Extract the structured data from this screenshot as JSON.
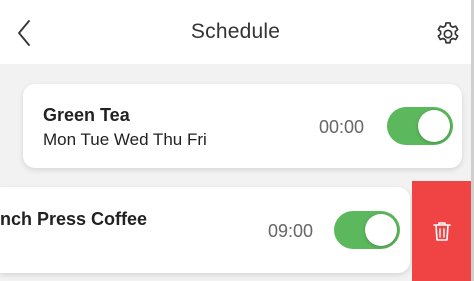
{
  "header": {
    "title": "Schedule",
    "back_icon": "chevron-left-icon",
    "settings_icon": "gear-icon"
  },
  "schedules": [
    {
      "name": "Green Tea",
      "days": "Mon Tue Wed Thu Fri",
      "time": "00:00",
      "enabled": true
    },
    {
      "name": "nch Press Coffee",
      "days": "",
      "time": "09:00",
      "enabled": true
    }
  ],
  "swipe_action": {
    "icon": "trash-icon",
    "color": "#f04444"
  },
  "colors": {
    "toggle_on": "#5cb85c",
    "delete": "#f04444"
  }
}
